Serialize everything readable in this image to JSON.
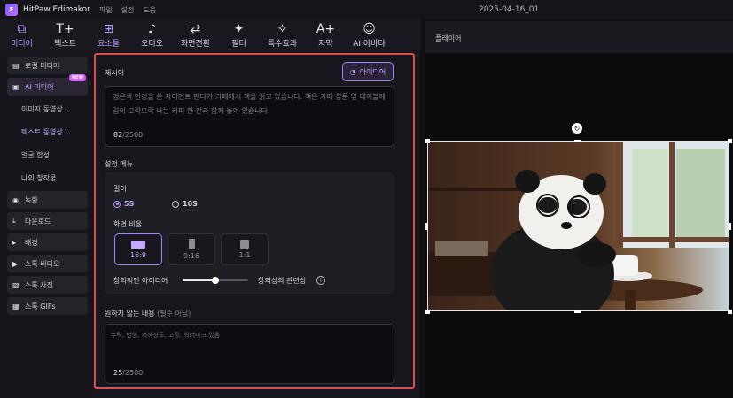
{
  "app": {
    "name": "HitPaw Edimakor",
    "menu": [
      "파일",
      "설정",
      "도움"
    ],
    "project_title": "2025-04-16_01"
  },
  "toolbar": [
    {
      "label": "미디어",
      "icon": "media-icon",
      "glyph": "⧉"
    },
    {
      "label": "텍스트",
      "icon": "text-icon",
      "glyph": "T+"
    },
    {
      "label": "요소들",
      "icon": "elements-icon",
      "glyph": "⊞"
    },
    {
      "label": "오디오",
      "icon": "audio-icon",
      "glyph": "♪"
    },
    {
      "label": "화면전환",
      "icon": "transition-icon",
      "glyph": "⇄"
    },
    {
      "label": "필터",
      "icon": "filter-icon",
      "glyph": "✦"
    },
    {
      "label": "특수효과",
      "icon": "effects-icon",
      "glyph": "✧"
    },
    {
      "label": "자막",
      "icon": "subtitle-icon",
      "glyph": "A+"
    },
    {
      "label": "AI 아바타",
      "icon": "avatar-icon",
      "glyph": "☺"
    }
  ],
  "sidebar": {
    "local_media": "로컬 미디어",
    "ai_media": "AI 미디어",
    "new_badge": "NEW",
    "subs": [
      "이미지 동영상 ...",
      "텍스트 동영상 ...",
      "얼굴 합성",
      "나의 창작물"
    ],
    "items": [
      "녹화",
      "다운로드",
      "배경",
      "스톡 비디오",
      "스톡 사진",
      "스톡 GIFs"
    ]
  },
  "prompt": {
    "title": "제시어",
    "idea_button": "아이디어",
    "text": "경은색 안경을 쓴 자이언트 판다가 카페에서 책을 읽고 있습니다. 책은 카페 창문 옆 테이블에 김이 모락모락 나는 커피 한 잔과 함께 놓여 있습니다.",
    "count": "82",
    "max": "/2500"
  },
  "settings": {
    "title": "설정 메뉴",
    "length_label": "길이",
    "length_options": [
      "5S",
      "10S"
    ],
    "length_selected": "5S",
    "ratio_label": "화면 비율",
    "ratios": [
      "16:9",
      "9:16",
      "1:1"
    ],
    "ratio_selected": "16:9",
    "creativity_label": "창의적인 아이디어",
    "relevance_label": "창의성의 관련성",
    "creativity_value": 0.5
  },
  "negative": {
    "title": "원하지 않는 내용",
    "optional": "(필수 아님)",
    "placeholder": "누락, 변형, 저해상도, 고장, 워터마크 있음",
    "count": "25",
    "max": "/2500"
  },
  "player": {
    "title": "플레이어"
  }
}
